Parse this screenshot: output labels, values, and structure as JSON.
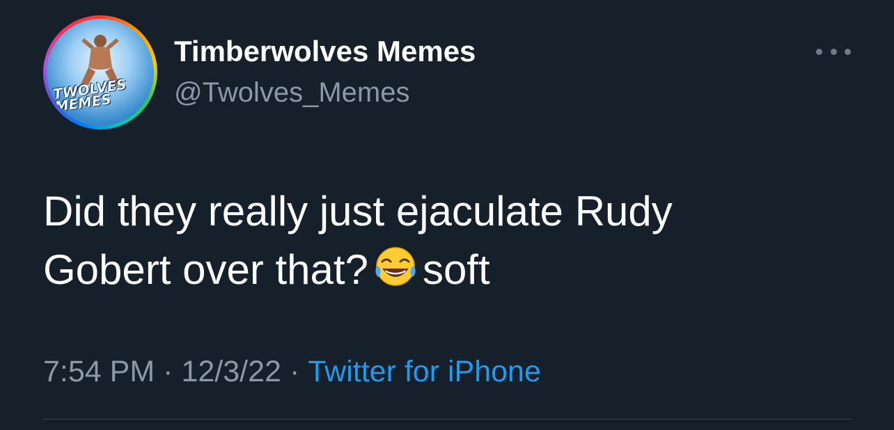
{
  "theme": {
    "background": "#15202b",
    "text_primary": "#ffffff",
    "text_secondary": "#8b98a5",
    "accent": "#1d9bf0"
  },
  "author": {
    "display_name": "Timberwolves Memes",
    "handle": "@Twolves_Memes",
    "avatar": {
      "icon": "avatar-image",
      "text_line1": "TWOLVES",
      "text_line2": "MEMES"
    }
  },
  "more_menu": {
    "icon": "more-horizontal-icon"
  },
  "tweet": {
    "line1": "Did they really just ejaculate Rudy",
    "line2_before": "Gobert over that?",
    "emoji": "face-with-tears-of-joy",
    "line2_after": "soft"
  },
  "meta": {
    "time": "7:54 PM",
    "date": "12/3/22",
    "separator": "·",
    "source": "Twitter for iPhone"
  }
}
